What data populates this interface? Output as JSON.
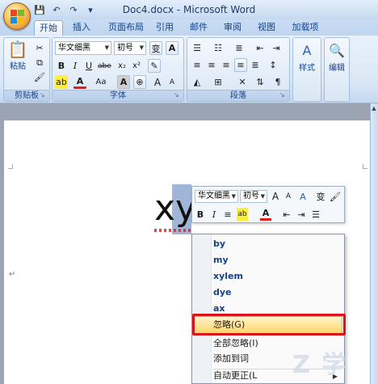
{
  "window": {
    "title": "Doc4.docx - Microsoft Word"
  },
  "quick_access": {
    "save_icon": "save-icon",
    "undo_icon": "undo-icon",
    "redo_icon": "redo-icon",
    "customize_icon": "customize-icon"
  },
  "tabs": [
    {
      "label": "开始",
      "active": true
    },
    {
      "label": "插入"
    },
    {
      "label": "页面布局"
    },
    {
      "label": "引用"
    },
    {
      "label": "邮件"
    },
    {
      "label": "审阅"
    },
    {
      "label": "视图"
    },
    {
      "label": "加载项"
    }
  ],
  "ribbon": {
    "clipboard": {
      "label": "剪贴板",
      "paste": "粘贴"
    },
    "font": {
      "label": "字体",
      "font_name": "华文细黑",
      "font_size": "初号",
      "bold": "B",
      "italic": "I",
      "underline": "U",
      "strike": "abe",
      "subscript": "x₂",
      "superscript": "x²",
      "change_case": "Aa",
      "char_shading": "A",
      "grow_font": "A",
      "shrink_font": "A"
    },
    "paragraph": {
      "label": "段落"
    },
    "styles": {
      "label": "样式"
    },
    "editing": {
      "label": "编辑"
    }
  },
  "document": {
    "text_x": "x",
    "text_y": "y",
    "paragraph_mark": "↵"
  },
  "mini_toolbar": {
    "font_name": "华文细黑",
    "font_size": "初号",
    "bold": "B",
    "italic": "I"
  },
  "context_menu": {
    "suggestions": [
      "by",
      "my",
      "xylem",
      "dye",
      "ax"
    ],
    "ignore": "忽略(G)",
    "ignore_all": "全部忽略(I)",
    "add_to_dict": "添加到词",
    "autocorrect": "自动更正(L"
  },
  "watermark": "Z 学"
}
